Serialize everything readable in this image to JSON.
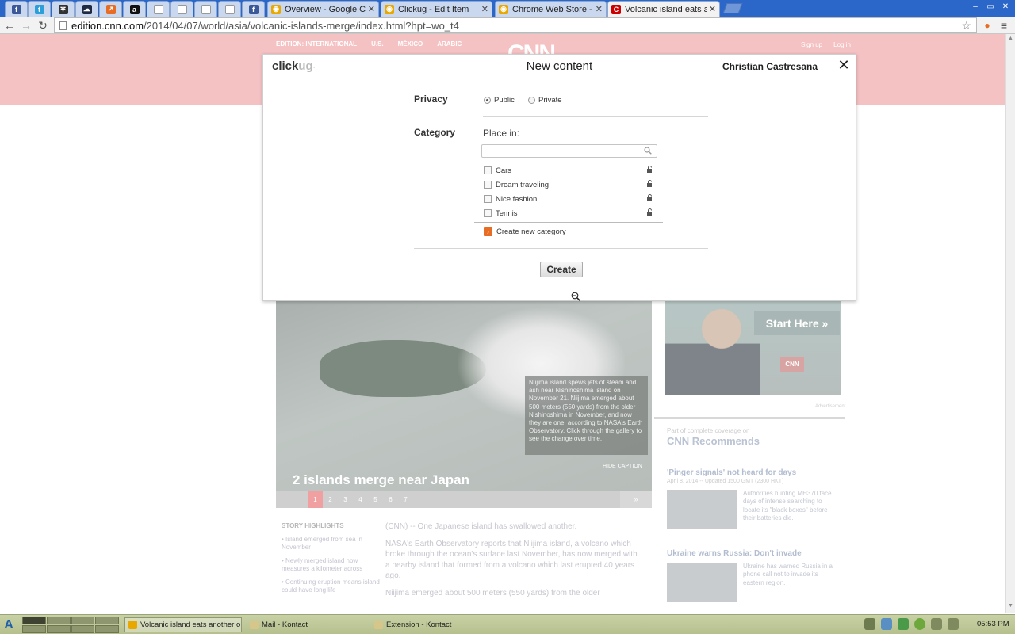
{
  "browser": {
    "tabs": [
      {
        "title": "",
        "icon": "facebook-icon",
        "color": "#3b5998",
        "glyph": "f"
      },
      {
        "title": "",
        "icon": "twitter-icon",
        "color": "#2b9fd9",
        "glyph": "t"
      },
      {
        "title": "",
        "icon": "extension-gear-icon",
        "color": "#333333",
        "glyph": "✲"
      },
      {
        "title": "",
        "icon": "soundcloud-icon",
        "color": "#1f2a44",
        "glyph": "☁"
      },
      {
        "title": "",
        "icon": "chart-icon",
        "color": "#e86d24",
        "glyph": "↗"
      },
      {
        "title": "",
        "icon": "amazon-icon",
        "color": "#111111",
        "glyph": "a"
      },
      {
        "title": "",
        "icon": "page-icon",
        "color": "#ffffff",
        "glyph": ""
      },
      {
        "title": "",
        "icon": "page-icon",
        "color": "#ffffff",
        "glyph": ""
      },
      {
        "title": "",
        "icon": "page-icon",
        "color": "#ffffff",
        "glyph": ""
      },
      {
        "title": "",
        "icon": "page-icon",
        "color": "#ffffff",
        "glyph": ""
      },
      {
        "title": "",
        "icon": "facebook-icon",
        "color": "#3b5998",
        "glyph": "f"
      },
      {
        "title": "Overview - Google Chro",
        "icon": "chrome-icon",
        "color": "#e8a800",
        "glyph": "◉"
      },
      {
        "title": "Clickug - Edit Item",
        "icon": "chrome-icon",
        "color": "#e8a800",
        "glyph": "◉"
      },
      {
        "title": "Chrome Web Store - He",
        "icon": "chrome-icon",
        "color": "#e8a800",
        "glyph": "◉"
      },
      {
        "title": "Volcanic island eats anc",
        "icon": "cnn-icon",
        "color": "#cc0000",
        "glyph": "C"
      }
    ],
    "url_host": "edition.cnn.com",
    "url_path": "/2014/04/07/world/asia/volcanic-islands-merge/index.html?hpt=wo_t4"
  },
  "cnn": {
    "edition_items": [
      "EDITION: INTERNATIONAL",
      "U.S.",
      "MÉXICO",
      "ARABIC"
    ],
    "logo": "CNN",
    "account_links": [
      "Sign up",
      "Log in"
    ],
    "gallery": {
      "title": "2 islands merge near Japan",
      "caption": "Niijima island spews jets of steam and ash near Nishinoshima island on November 21. Niijima emerged about 500 meters (550 yards) from the older Nishinoshima in November, and now they are one, according to NASA's Earth Observatory. Click through the gallery to see the change over time.",
      "hide_caption": "HIDE CAPTION",
      "pages": [
        "1",
        "2",
        "3",
        "4",
        "5",
        "6",
        "7"
      ],
      "next": "»"
    },
    "highlights_heading": "STORY HIGHLIGHTS",
    "highlights": [
      "Island emerged from sea in November",
      "Newly merged island now measures a kilometer across",
      "Continuing eruption means island could have long life"
    ],
    "article": [
      "(CNN) -- One Japanese island has swallowed another.",
      "NASA's Earth Observatory reports that Niijima island, a volcano which broke through the ocean's surface last November, has now merged with a nearby island that formed from a volcano which last erupted 40 years ago.",
      "Niijima emerged about 500 meters (550 yards) from the older"
    ],
    "ad": {
      "cta": "Start Here »",
      "badge": "CNN",
      "label": "Advertisement"
    },
    "recommends_kicker": "Part of complete coverage on",
    "recommends_title": "CNN Recommends",
    "stories": [
      {
        "headline": "'Pinger signals' not heard for days",
        "meta": "April 8, 2014 -- Updated 1500 GMT (2300 HKT)",
        "blurb": "Authorities hunting MH370 face days of intense searching to locate its \"black boxes\" before their batteries die."
      },
      {
        "headline": "Ukraine warns Russia: Don't invade",
        "meta": "",
        "blurb": "Ukraine has warned Russia in a phone call not to invade its eastern region."
      }
    ]
  },
  "modal": {
    "brand_main": "click",
    "brand_ug": "ug",
    "brand_dot": "·",
    "title": "New content",
    "user": "Christian Castresana",
    "close": "✕",
    "privacy_label": "Privacy",
    "privacy_options": [
      {
        "label": "Public",
        "checked": true
      },
      {
        "label": "Private",
        "checked": false
      }
    ],
    "category_label": "Category",
    "place_in": "Place in:",
    "search_placeholder": "",
    "categories": [
      {
        "name": "Cars",
        "checked": false
      },
      {
        "name": "Dream traveling",
        "checked": false
      },
      {
        "name": "Nice fashion",
        "checked": false
      },
      {
        "name": "Tennis",
        "checked": false
      }
    ],
    "create_category": "Create new category",
    "create_button": "Create",
    "accent_color": "#e86d24"
  },
  "taskbar": {
    "start_glyph": "A",
    "tasks": [
      {
        "title": "Volcanic island eats another o",
        "active": true,
        "icon": "chrome-icon"
      },
      {
        "title": "Mail - Kontact",
        "active": false,
        "icon": "mail-icon"
      },
      {
        "title": "Extension - Kontact",
        "active": false,
        "icon": "notes-icon"
      }
    ],
    "clock": "05:53 PM"
  }
}
